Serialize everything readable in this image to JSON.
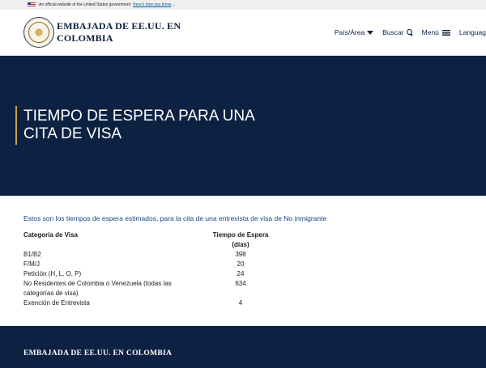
{
  "gov_banner": {
    "text": "An official website of the United States government",
    "link": "Here's how you know"
  },
  "header": {
    "title_line1": "EMBAJADA DE EE.UU. EN",
    "title_line2": "COLOMBIA",
    "nav": {
      "country": "País/Área",
      "search": "Buscar",
      "menu": "Menú",
      "language": "Languag"
    }
  },
  "hero": {
    "title_line1": "TIEMPO DE ESPERA PARA UNA",
    "title_line2": "CITA DE VISA"
  },
  "content": {
    "intro": "Estos son los tiempos de espera estimados, para la cita de una entrevista de visa de No inmigrante",
    "table": {
      "header_category": "Categoría de Visa",
      "header_wait_line1": "Tiempo de Espera",
      "header_wait_line2": "(días)",
      "rows": [
        {
          "category": "B1/B2",
          "wait": "398"
        },
        {
          "category": "F/M/J",
          "wait": "20"
        },
        {
          "category": "Petición (H, L, O, P)",
          "wait": "24"
        },
        {
          "category_line1": "No Residentes de Colombia o Venezuela (todas las",
          "category_line2": "categorías de visa)",
          "wait": "634"
        },
        {
          "category": "Exención de Entrevista",
          "wait": "4"
        }
      ]
    }
  },
  "footer": {
    "title": "EMBAJADA DE EE.UU. EN COLOMBIA"
  },
  "colors": {
    "navy": "#0d2242",
    "gold_accent": "#c7a04c",
    "link_blue": "#005ea2"
  }
}
